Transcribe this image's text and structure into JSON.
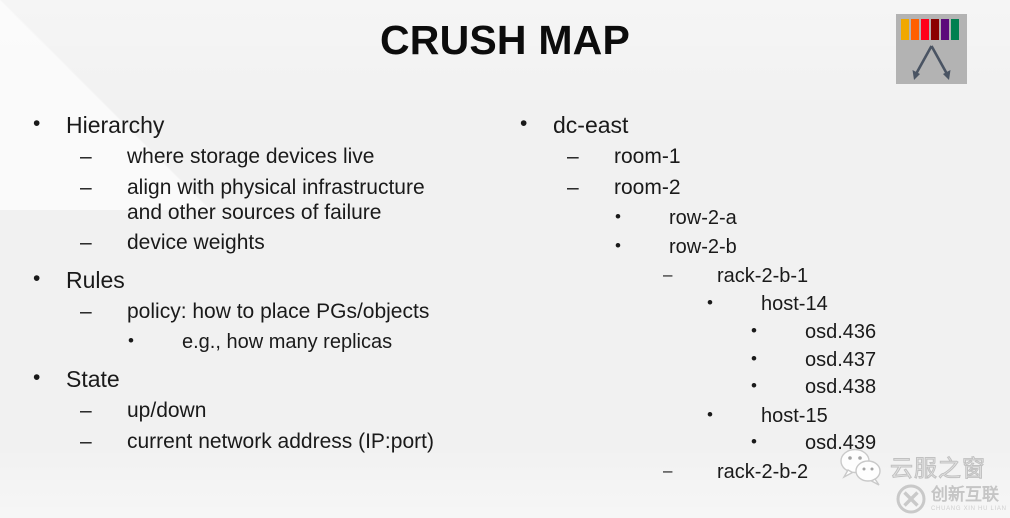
{
  "slide": {
    "title": "CRUSH MAP",
    "background_color": "#f1f1f1",
    "text_color": "#1a1a1a"
  },
  "logo": {
    "name": "ceph-crush-logo",
    "box_color": "#b3b3b3",
    "arrow_color": "#4a5463",
    "bar_colors": [
      "#f0a800",
      "#ff6000",
      "#ff0018",
      "#8b0000",
      "#5b0a7a",
      "#008050"
    ]
  },
  "left_column": {
    "items": [
      {
        "level": 1,
        "marker": "•",
        "text": "Hierarchy"
      },
      {
        "level": 2,
        "marker": "–",
        "text": "where storage devices live"
      },
      {
        "level": 2,
        "marker": "–",
        "text": "align with physical infrastructure\nand other sources of failure"
      },
      {
        "level": 2,
        "marker": "–",
        "text": "device weights"
      },
      {
        "level": 1,
        "marker": "•",
        "text": "Rules"
      },
      {
        "level": 2,
        "marker": "–",
        "text": "policy: how to place PGs/objects"
      },
      {
        "level": 3,
        "marker": "•",
        "text": "e.g., how many replicas"
      },
      {
        "level": 1,
        "marker": "•",
        "text": "State"
      },
      {
        "level": 2,
        "marker": "–",
        "text": "up/down"
      },
      {
        "level": 2,
        "marker": "–",
        "text": "current network address (IP:port)"
      }
    ]
  },
  "right_column": {
    "items": [
      {
        "level": 1,
        "marker": "•",
        "text": "dc-east"
      },
      {
        "level": 2,
        "marker": "–",
        "text": "room-1"
      },
      {
        "level": 2,
        "marker": "–",
        "text": "room-2"
      },
      {
        "level": 3,
        "marker": "•",
        "text": "row-2-a"
      },
      {
        "level": 3,
        "marker": "•",
        "text": "row-2-b"
      },
      {
        "level": 4,
        "marker": "–",
        "text": "rack-2-b-1"
      },
      {
        "level": 5,
        "marker": "•",
        "text": "host-14"
      },
      {
        "level": 6,
        "marker": "•",
        "text": "osd.436"
      },
      {
        "level": 6,
        "marker": "•",
        "text": "osd.437"
      },
      {
        "level": 6,
        "marker": "•",
        "text": "osd.438"
      },
      {
        "level": 5,
        "marker": "•",
        "text": "host-15"
      },
      {
        "level": 6,
        "marker": "•",
        "text": "osd.439"
      },
      {
        "level": 4,
        "marker": "–",
        "text": "rack-2-b-2"
      }
    ]
  },
  "watermarks": {
    "wechat": {
      "text": "云服之窗"
    },
    "cxhl": {
      "cn": "创新互联",
      "en": "CHUANG XIN HU LIAN"
    }
  }
}
